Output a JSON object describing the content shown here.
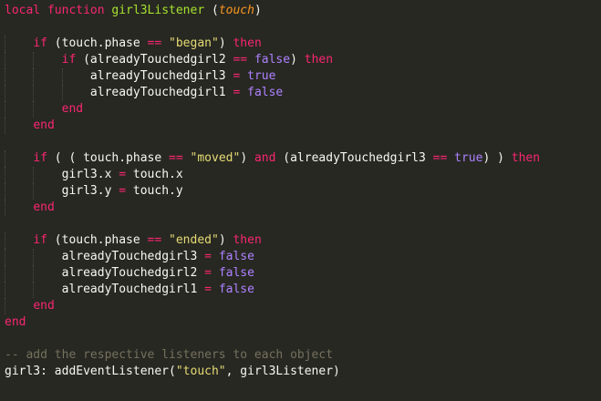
{
  "editor": {
    "theme": {
      "background": "#272822",
      "text": "#f8f8f2",
      "keyword": "#f92672",
      "function_name": "#a6e22e",
      "parameter": "#fd971f",
      "string": "#e6db74",
      "constant": "#ae81ff",
      "comment": "#75715e"
    },
    "lines": [
      {
        "indent": 0,
        "tokens": [
          {
            "t": "local function ",
            "c": "kw"
          },
          {
            "t": "girl3Listener",
            "c": "fn"
          },
          {
            "t": " (",
            "c": "id"
          },
          {
            "t": "touch",
            "c": "param"
          },
          {
            "t": ")",
            "c": "id"
          }
        ]
      },
      {
        "indent": 0,
        "tokens": []
      },
      {
        "indent": 1,
        "tokens": [
          {
            "t": "if",
            "c": "kw"
          },
          {
            "t": " (touch.phase ",
            "c": "id"
          },
          {
            "t": "==",
            "c": "op"
          },
          {
            "t": " ",
            "c": "id"
          },
          {
            "t": "\"began\"",
            "c": "str"
          },
          {
            "t": ") ",
            "c": "id"
          },
          {
            "t": "then",
            "c": "kw"
          }
        ]
      },
      {
        "indent": 2,
        "tokens": [
          {
            "t": "if",
            "c": "kw"
          },
          {
            "t": " (alreadyTouchedgirl2 ",
            "c": "id"
          },
          {
            "t": "==",
            "c": "op"
          },
          {
            "t": " ",
            "c": "id"
          },
          {
            "t": "false",
            "c": "const"
          },
          {
            "t": ") ",
            "c": "id"
          },
          {
            "t": "then",
            "c": "kw"
          }
        ]
      },
      {
        "indent": 3,
        "tokens": [
          {
            "t": "alreadyTouchedgirl3 ",
            "c": "id"
          },
          {
            "t": "=",
            "c": "op"
          },
          {
            "t": " ",
            "c": "id"
          },
          {
            "t": "true",
            "c": "const"
          }
        ]
      },
      {
        "indent": 3,
        "tokens": [
          {
            "t": "alreadyTouchedgirl1 ",
            "c": "id"
          },
          {
            "t": "=",
            "c": "op"
          },
          {
            "t": " ",
            "c": "id"
          },
          {
            "t": "false",
            "c": "const"
          }
        ]
      },
      {
        "indent": 2,
        "tokens": [
          {
            "t": "end",
            "c": "kw"
          }
        ]
      },
      {
        "indent": 1,
        "tokens": [
          {
            "t": "end",
            "c": "kw"
          }
        ]
      },
      {
        "indent": 0,
        "tokens": []
      },
      {
        "indent": 1,
        "tokens": [
          {
            "t": "if",
            "c": "kw"
          },
          {
            "t": " ( ( touch.phase ",
            "c": "id"
          },
          {
            "t": "==",
            "c": "op"
          },
          {
            "t": " ",
            "c": "id"
          },
          {
            "t": "\"moved\"",
            "c": "str"
          },
          {
            "t": ") ",
            "c": "id"
          },
          {
            "t": "and",
            "c": "kw"
          },
          {
            "t": " (alreadyTouchedgirl3 ",
            "c": "id"
          },
          {
            "t": "==",
            "c": "op"
          },
          {
            "t": " ",
            "c": "id"
          },
          {
            "t": "true",
            "c": "const"
          },
          {
            "t": ") ) ",
            "c": "id"
          },
          {
            "t": "then",
            "c": "kw"
          }
        ]
      },
      {
        "indent": 2,
        "tokens": [
          {
            "t": "girl3.x ",
            "c": "id"
          },
          {
            "t": "=",
            "c": "op"
          },
          {
            "t": " touch.x",
            "c": "id"
          }
        ]
      },
      {
        "indent": 2,
        "tokens": [
          {
            "t": "girl3.y ",
            "c": "id"
          },
          {
            "t": "=",
            "c": "op"
          },
          {
            "t": " touch.y",
            "c": "id"
          }
        ]
      },
      {
        "indent": 1,
        "tokens": [
          {
            "t": "end",
            "c": "kw"
          }
        ]
      },
      {
        "indent": 0,
        "tokens": []
      },
      {
        "indent": 1,
        "tokens": [
          {
            "t": "if",
            "c": "kw"
          },
          {
            "t": " (touch.phase ",
            "c": "id"
          },
          {
            "t": "==",
            "c": "op"
          },
          {
            "t": " ",
            "c": "id"
          },
          {
            "t": "\"ended\"",
            "c": "str"
          },
          {
            "t": ") ",
            "c": "id"
          },
          {
            "t": "then",
            "c": "kw"
          }
        ]
      },
      {
        "indent": 2,
        "tokens": [
          {
            "t": "alreadyTouchedgirl3 ",
            "c": "id"
          },
          {
            "t": "=",
            "c": "op"
          },
          {
            "t": " ",
            "c": "id"
          },
          {
            "t": "false",
            "c": "const"
          }
        ]
      },
      {
        "indent": 2,
        "tokens": [
          {
            "t": "alreadyTouchedgirl2 ",
            "c": "id"
          },
          {
            "t": "=",
            "c": "op"
          },
          {
            "t": " ",
            "c": "id"
          },
          {
            "t": "false",
            "c": "const"
          }
        ]
      },
      {
        "indent": 2,
        "tokens": [
          {
            "t": "alreadyTouchedgirl1 ",
            "c": "id"
          },
          {
            "t": "=",
            "c": "op"
          },
          {
            "t": " ",
            "c": "id"
          },
          {
            "t": "false",
            "c": "const"
          }
        ]
      },
      {
        "indent": 1,
        "tokens": [
          {
            "t": "end",
            "c": "kw"
          }
        ]
      },
      {
        "indent": 0,
        "tokens": [
          {
            "t": "end",
            "c": "kw"
          }
        ]
      },
      {
        "indent": 0,
        "tokens": []
      },
      {
        "indent": 0,
        "tokens": [
          {
            "t": "-- add the respective listeners to each object",
            "c": "cm"
          }
        ]
      },
      {
        "indent": 0,
        "tokens": [
          {
            "t": "girl3: addEventListener(",
            "c": "id"
          },
          {
            "t": "\"touch\"",
            "c": "str"
          },
          {
            "t": ", girl3Listener)",
            "c": "id"
          }
        ]
      }
    ]
  }
}
